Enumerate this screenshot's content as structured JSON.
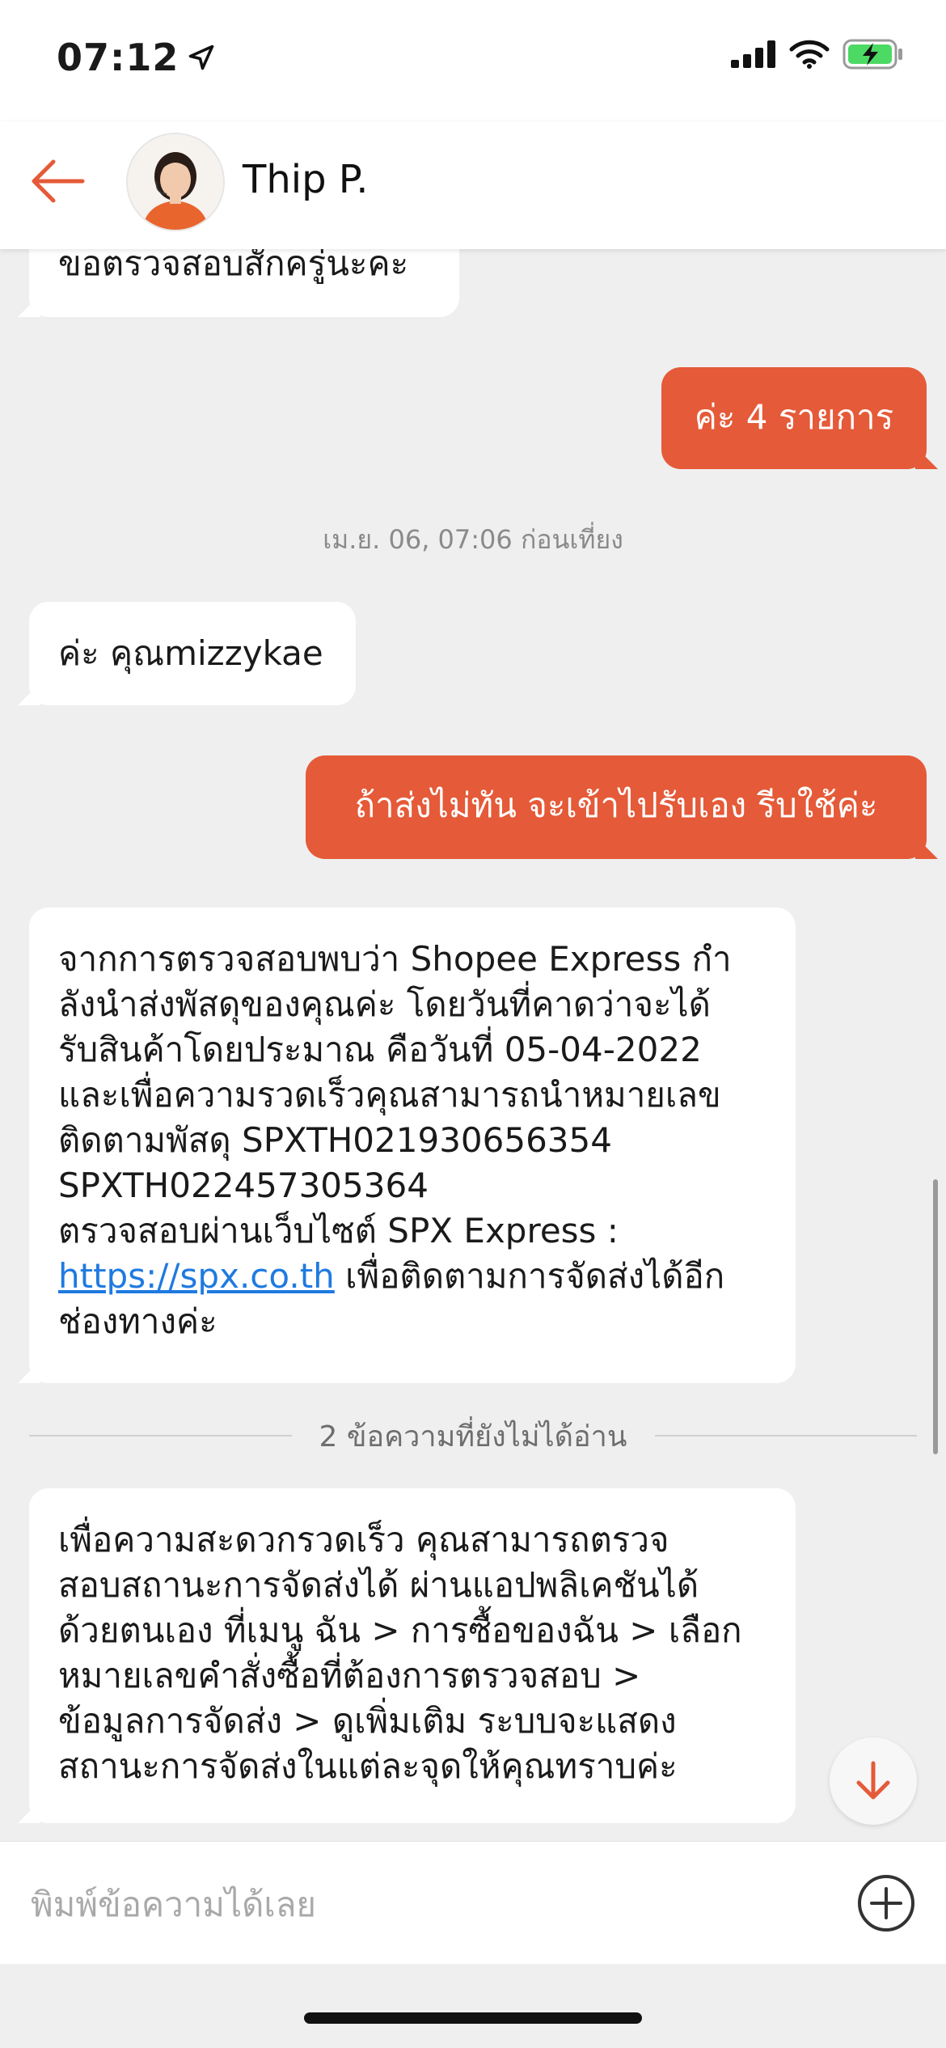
{
  "status_bar": {
    "time": "07:12"
  },
  "header": {
    "contact_name": "Thip P."
  },
  "messages": [
    {
      "id": 0,
      "side": "in",
      "text": "ขอตรวจสอบสักครู่นะคะ"
    },
    {
      "id": 1,
      "side": "out",
      "text": "ค่ะ 4 รายการ"
    },
    {
      "id": 2,
      "side": "in",
      "text": "ค่ะ คุณmizzykae"
    },
    {
      "id": 3,
      "side": "out",
      "text": "ถ้าส่งไม่ทัน จะเข้าไปรับเอง รีบใช้ค่ะ"
    },
    {
      "id": 4,
      "side": "in",
      "lines": [
        "จากการตรวจสอบพบว่า Shopee Express กำ",
        "ลังนำส่งพัสดุของคุณค่ะ  โดยวันที่คาดว่าจะได้",
        "รับสินค้าโดยประมาณ คือวันที่ 05-04-2022",
        "และเพื่อความรวดเร็วคุณสามารถนำหมายเลข",
        "ติดตามพัสดุ SPXTH021930656354",
        "SPXTH022457305364",
        "ตรวจสอบผ่านเว็บไซต์  SPX Express :"
      ],
      "link_text": "https://spx.co.th",
      "after_link": " เพื่อติดตามการจัดส่งได้อีก",
      "last_line": "ช่องทางค่ะ"
    },
    {
      "id": 5,
      "side": "in",
      "lines": [
        "เพื่อความสะดวกรวดเร็ว คุณสามารถตรวจ",
        "สอบสถานะการจัดส่งได้ ผ่านแอปพลิเคชันได้",
        "ด้วยตนเอง ที่เมนู ฉัน > การซื้อของฉัน > เลือก",
        "หมายเลขคำสั่งซื้อที่ต้องการตรวจสอบ >",
        "ข้อมูลการจัดส่ง > ดูเพิ่มเติม ระบบจะแสดง",
        "สถานะการจัดส่งในแต่ละจุดให้คุณทราบค่ะ"
      ]
    }
  ],
  "timestamp": "เม.ย. 06, 07:06 ก่อนเที่ยง",
  "unread_divider": "2 ข้อความที่ยังไม่ได้อ่าน",
  "input": {
    "placeholder": "พิมพ์ข้อความได้เลย"
  },
  "icons": {
    "location": "location-arrow-icon",
    "signal": "signal-icon",
    "wifi": "wifi-icon",
    "battery": "battery-charging-icon",
    "back": "arrow-left-icon",
    "scroll_down": "arrow-down-icon",
    "plus": "plus-circle-icon"
  },
  "colors": {
    "accent": "#e55a38",
    "link": "#1f7ae0",
    "battery": "#4cd964"
  }
}
